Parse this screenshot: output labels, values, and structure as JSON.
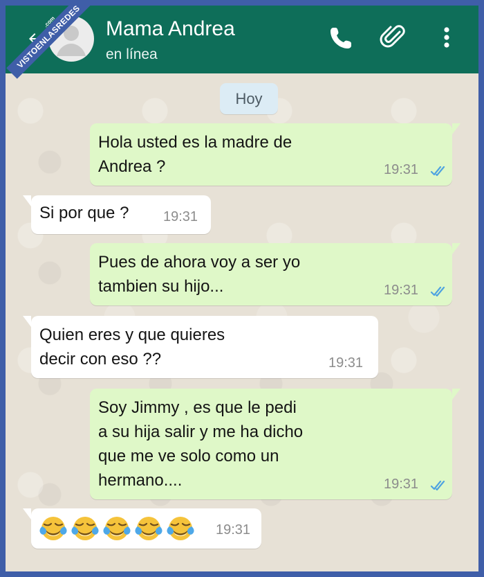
{
  "header": {
    "contact_name": "Mama Andrea",
    "status": "en línea",
    "icons": [
      "back-arrow-icon",
      "avatar-icon",
      "phone-icon",
      "paperclip-icon",
      "more-vert-icon"
    ],
    "header_color": "#0e6e59"
  },
  "watermark": {
    "text": "VISTOENLASREDES",
    "suffix": ".com"
  },
  "chat": {
    "day_label": "Hoy",
    "messages": [
      {
        "direction": "outgoing",
        "text": "Hola usted es la madre de\nAndrea ?",
        "time": "19:31",
        "read": true
      },
      {
        "direction": "incoming",
        "text": "Si por que ?",
        "time": "19:31"
      },
      {
        "direction": "outgoing",
        "text": "Pues de ahora voy a ser yo\ntambien su hijo...",
        "time": "19:31",
        "read": true
      },
      {
        "direction": "incoming",
        "text": "Quien eres y que quieres\ndecir con eso ??",
        "time": "19:31"
      },
      {
        "direction": "outgoing",
        "text": "Soy Jimmy , es que le pedi\na su hija salir y me ha dicho\nque me ve solo como un\nhermano....",
        "time": "19:31",
        "read": true
      },
      {
        "direction": "incoming",
        "emoji": [
          "face-with-tears-of-joy-icon",
          "face-with-tears-of-joy-icon",
          "face-with-tears-of-joy-icon",
          "face-with-tears-of-joy-icon",
          "face-with-tears-of-joy-icon"
        ],
        "time": "19:31"
      }
    ]
  },
  "colors": {
    "outgoing_bubble": "#dff8c8",
    "incoming_bubble": "#ffffff",
    "read_ticks": "#4fa3e0",
    "frame_border": "#3f5ea8"
  }
}
